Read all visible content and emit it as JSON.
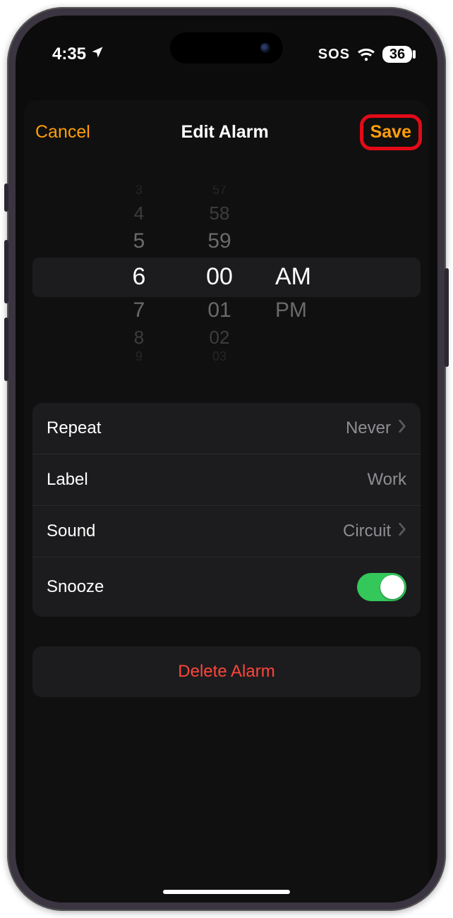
{
  "status": {
    "time": "4:35",
    "sos": "SOS",
    "battery": "36"
  },
  "nav": {
    "cancel": "Cancel",
    "title": "Edit Alarm",
    "save": "Save"
  },
  "picker": {
    "hours": [
      "3",
      "4",
      "5",
      "6",
      "7",
      "8",
      "9"
    ],
    "minutes": [
      "57",
      "58",
      "59",
      "00",
      "01",
      "02",
      "03"
    ],
    "ampm": [
      "AM",
      "PM"
    ],
    "selected": {
      "hour": "6",
      "minute": "00",
      "ampm": "AM"
    }
  },
  "rows": {
    "repeat": {
      "label": "Repeat",
      "value": "Never"
    },
    "label": {
      "label": "Label",
      "value": "Work"
    },
    "sound": {
      "label": "Sound",
      "value": "Circuit"
    },
    "snooze": {
      "label": "Snooze",
      "on": true
    }
  },
  "delete": "Delete Alarm",
  "colors": {
    "accent": "#ff9f0a",
    "destructive": "#ff453a",
    "toggle_on": "#34c759",
    "highlight_ring": "#e40a17"
  }
}
